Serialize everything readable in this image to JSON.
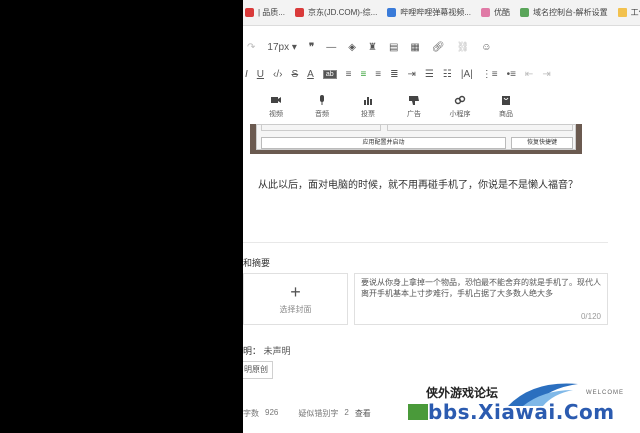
{
  "bookmarks": [
    {
      "label": "| 品质...",
      "color": "red"
    },
    {
      "label": "京东(JD.COM)-综...",
      "color": "red"
    },
    {
      "label": "哔哩哔哩弹幕视频...",
      "color": "blue"
    },
    {
      "label": "优酷",
      "color": "pink"
    },
    {
      "label": "域名控制台-解析设置",
      "color": "green"
    },
    {
      "label": "工作常用",
      "color": "folder"
    }
  ],
  "toolbar": {
    "font_size": "17px"
  },
  "insert_items": [
    {
      "label": "视频",
      "icon": "video-icon"
    },
    {
      "label": "音频",
      "icon": "microphone-icon"
    },
    {
      "label": "投票",
      "icon": "bar-chart-icon"
    },
    {
      "label": "广告",
      "icon": "thumbs-down-icon"
    },
    {
      "label": "小程序",
      "icon": "mini-program-icon"
    },
    {
      "label": "商品",
      "icon": "shopping-bag-icon"
    }
  ],
  "embed": {
    "button1": "应用配置并启动",
    "button2": "恢复快捷键"
  },
  "article": {
    "paragraph": "从此以后，面对电脑的时候，就不用再碰手机了，你说是不是懒人福音？"
  },
  "section": {
    "cover_summary_label": "和摘要",
    "choose_cover": "选择封面",
    "summary_text": "要说从你身上拿掉一个物品，恐怕最不能舍弃的就是手机了。现代人离开手机基本上寸步难行，手机占据了大多数人绝大多",
    "summary_count": "0/120"
  },
  "declaration": {
    "label": "明：",
    "value": "未声明",
    "original_button": "明原创"
  },
  "footer": {
    "word_count_label": "字数",
    "word_count": "926",
    "typo_label": "疑似错别字",
    "typo_count": "2",
    "view_link": "查看"
  },
  "watermark": {
    "title": "侠外游戏论坛",
    "domain": "bbs.Xiawai.Com",
    "welcome": "WELCOME"
  }
}
